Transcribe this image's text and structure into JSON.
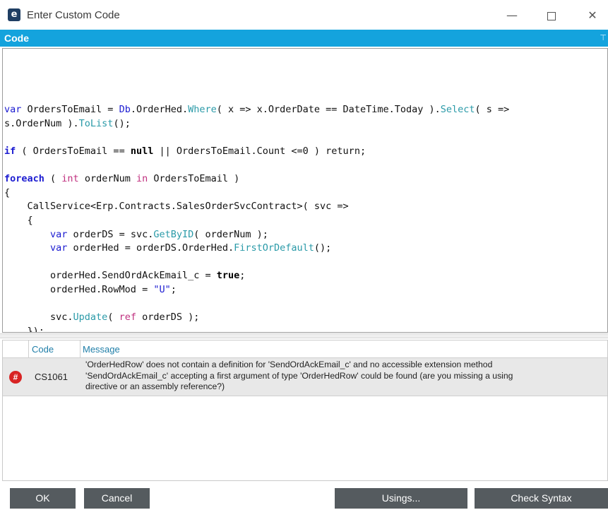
{
  "window": {
    "title": "Enter Custom Code",
    "logo_letter": "e",
    "minimize_glyph": "—",
    "close_glyph": "✕"
  },
  "code_section": {
    "header": "Code",
    "pin_glyph": "⊤"
  },
  "code_lines": [
    [],
    [],
    [
      {
        "t": "var",
        "c": "kw"
      },
      {
        "t": " OrdersToEmail = "
      },
      {
        "t": "Db",
        "c": "kw"
      },
      {
        "t": ".OrderHed."
      },
      {
        "t": "Where",
        "c": "m"
      },
      {
        "t": "( x => x.OrderDate == DateTime.Today )."
      },
      {
        "t": "Select",
        "c": "m"
      },
      {
        "t": "( s =>"
      }
    ],
    [
      {
        "t": "s.OrderNum )."
      },
      {
        "t": "ToList",
        "c": "m"
      },
      {
        "t": "();"
      }
    ],
    [],
    [
      {
        "t": "if",
        "c": "kwb"
      },
      {
        "t": " ( OrdersToEmail == "
      },
      {
        "t": "null",
        "c": "nl"
      },
      {
        "t": " || OrdersToEmail.Count <=0 ) return;"
      }
    ],
    [],
    [
      {
        "t": "foreach",
        "c": "kwb"
      },
      {
        "t": " ( "
      },
      {
        "t": "int",
        "c": "r"
      },
      {
        "t": " orderNum "
      },
      {
        "t": "in",
        "c": "r"
      },
      {
        "t": " OrdersToEmail )"
      }
    ],
    [
      {
        "t": "{"
      }
    ],
    [
      {
        "t": "    CallService<Erp.Contracts.SalesOrderSvcContract>( svc =>"
      }
    ],
    [
      {
        "t": "    {"
      }
    ],
    [
      {
        "t": "        "
      },
      {
        "t": "var",
        "c": "kw"
      },
      {
        "t": " orderDS = svc."
      },
      {
        "t": "GetByID",
        "c": "m"
      },
      {
        "t": "( orderNum );"
      }
    ],
    [
      {
        "t": "        "
      },
      {
        "t": "var",
        "c": "kw"
      },
      {
        "t": " orderHed = orderDS.OrderHed."
      },
      {
        "t": "FirstOrDefault",
        "c": "m"
      },
      {
        "t": "();"
      }
    ],
    [],
    [
      {
        "t": "        orderHed.SendOrdAckEmail_c = "
      },
      {
        "t": "true",
        "c": "nl"
      },
      {
        "t": ";"
      }
    ],
    [
      {
        "t": "        orderHed.RowMod = "
      },
      {
        "t": "\"U\"",
        "c": "s"
      },
      {
        "t": ";"
      }
    ],
    [],
    [
      {
        "t": "        svc."
      },
      {
        "t": "Update",
        "c": "m"
      },
      {
        "t": "( "
      },
      {
        "t": "ref",
        "c": "r"
      },
      {
        "t": " orderDS );"
      }
    ],
    [
      {
        "t": "    });"
      }
    ],
    [
      {
        "t": "}"
      }
    ]
  ],
  "errors": {
    "columns": {
      "code": "Code",
      "message": "Message"
    },
    "rows": [
      {
        "icon": "error-icon",
        "icon_glyph": "#",
        "code": "CS1061",
        "message_lines": [
          "'OrderHedRow' does not contain a definition for 'SendOrdAckEmail_c' and no accessible extension method",
          "'SendOrdAckEmail_c' accepting a first argument of type 'OrderHedRow' could be found (are you missing a using",
          "directive or an assembly reference?)"
        ]
      }
    ]
  },
  "buttons": {
    "ok": "OK",
    "cancel": "Cancel",
    "usings": "Usings...",
    "check_syntax": "Check Syntax"
  }
}
